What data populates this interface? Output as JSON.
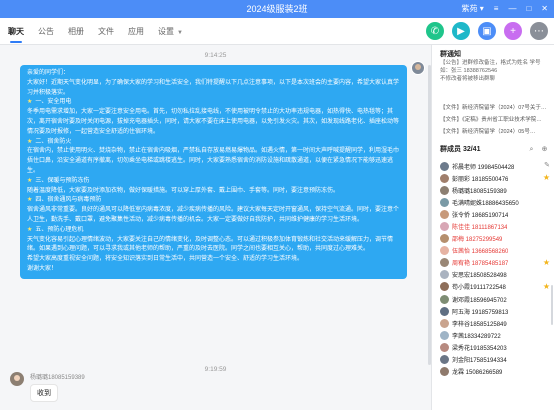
{
  "window": {
    "title": "2024级服装2班",
    "user_menu": "紫苑 ▾",
    "controls": [
      "≡",
      "—",
      "□",
      "✕"
    ]
  },
  "tabs": [
    {
      "label": "聊天",
      "active": true
    },
    {
      "label": "公告"
    },
    {
      "label": "相册"
    },
    {
      "label": "文件"
    },
    {
      "label": "应用"
    },
    {
      "label": "设置",
      "dropdown": true
    }
  ],
  "tab_actions": [
    {
      "icon": "phone-icon",
      "color": "#1fc58b",
      "glyph": "✆"
    },
    {
      "icon": "video-call-icon",
      "color": "#1fb8c9",
      "glyph": "▶"
    },
    {
      "icon": "screen-share-icon",
      "color": "#4c8df7",
      "glyph": "▣"
    },
    {
      "icon": "add-app-icon",
      "color": "#c86df0",
      "glyph": "+"
    },
    {
      "icon": "more-icon",
      "color": "#8a8f98",
      "glyph": "⋯"
    }
  ],
  "chat": {
    "timestamp_1": "9:14:25",
    "timestamp_2": "9:19:59",
    "announcement": {
      "greeting": "亲爱的同学们：",
      "intro": "大家好！近期天气变化明显，为了确保大家的学习和生活安全，我们特提醒以下几点注意事项，以下是本次班会的主要内容，希望大家认真学习并积极落实。",
      "sections": [
        {
          "heading": "一、安全用电",
          "body": "冬季用电需求增加，大家一定要注意安全用电。首先，切勿私拉乱接电线，不使用被明令禁止的大功率违规电器，如热得快、电热毯等；其次，离开宿舍时要及时关闭电源，拔掉充电器插头，同时，请大家不要在床上使用电器，以免引发火灾。其次，如发现线路老化、插座松动等情况要及时报修，一起营造安全舒适的住宿环境。"
        },
        {
          "heading": "二、宿舍防火",
          "body": "在宿舍内，禁止使用明火、焚烧杂物，禁止在宿舍内吸烟，严禁私自存放易燃易爆物品。如遇火情，第一时间大声呼喊提醒同学，利用湿毛巾捂住口鼻，沿安全通道有序撤离，切勿乘坐电梯或跳楼逃生。同时，大家要熟悉宿舍的消防设施和疏散通道，以便在紧急情况下能够迅速逃生。"
        },
        {
          "heading": "三、保暖与预防冻伤",
          "body": "随着温度降低，大家要及时添加衣物，做好保暖措施。可以穿上厚外套、戴上围巾、手套等。同时，要注意预防冻伤。"
        },
        {
          "heading": "四、宿舍通风与病毒预防",
          "body": "宿舍通风非常重要。良好的通风可以降低室内病毒浓度，减少疾病传播的风险。建议大家每天定时开窗通风，保持空气流通。同时，要注意个人卫生，勤洗手、戴口罩，避免聚集性活动，减少病毒传播的机会。大家一定要做好自我防护，共同维护健康的学习生活环境。"
        },
        {
          "heading": "五、预防心理危机",
          "body": "天气变化容易引起心理情绪波动，大家要关注自己的情绪变化，及时调整心态。可以通过积极参加体育锻炼和社交活动来缓解压力，调节情绪。如果遇到心理问题，可以寻求我或其他老师的帮助，严重的及时去医院。同学之间也要相互关心，帮助，共同度过心理难关。"
        }
      ],
      "closing": "希望大家高度重视安全问题，将安全知识落实到日常生活中，共同营造一个安全、舒适的学习生活环境。",
      "thanks": "谢谢大家！"
    },
    "reply": {
      "sender": "杨璐璐18085159389",
      "text": "收到"
    }
  },
  "panel": {
    "notice_title": "群通知",
    "notice_lines": [
      {
        "text": "【公告】进群修改备注，格式为姓名 学号",
        "highlight": false
      },
      {
        "text": "如：张三 18388762546",
        "highlight": false
      },
      {
        "text": "不修改者将被移出群聊",
        "highlight": false
      }
    ],
    "files": [
      "【文件】新经济院留学（2024）07号关于…",
      "【文件】《定稿》贵州省工职业技术学院…",
      "【文件】新经济院留学（2024）05号…"
    ],
    "members_label": "群成员 32/41",
    "members": [
      {
        "name": "祁晨老师 19984504428",
        "color": "#6d7b8c",
        "red": false,
        "edit": true
      },
      {
        "name": "彭丽彩 18185500476",
        "color": "#a07f6c",
        "red": false,
        "star": true
      },
      {
        "name": "杨璐璐18085159389",
        "color": "#8c7f72",
        "red": false
      },
      {
        "name": "毛满晴妮姝18886435650",
        "color": "#7a9aa6",
        "red": false
      },
      {
        "name": "张令侨 18685190714",
        "color": "#c79a7b",
        "red": false
      },
      {
        "name": "陈佳佳 18111867134",
        "color": "#d8a7b5",
        "red": true
      },
      {
        "name": "邵梅 18275299549",
        "color": "#b58f6d",
        "red": true
      },
      {
        "name": "伍茜怡 13668568260",
        "color": "#e6b3a3",
        "red": true
      },
      {
        "name": "周宥艳 18785485187",
        "color": "#9a8776",
        "red": true,
        "star": true
      },
      {
        "name": "安思宏18508528498",
        "color": "#aab3c0",
        "red": false
      },
      {
        "name": "苟小霞19111722548",
        "color": "#8e6f5b",
        "red": false,
        "star": true
      },
      {
        "name": "谢邓霞18596945702",
        "color": "#7e8d74",
        "red": false
      },
      {
        "name": "阿五海  19185759813",
        "color": "#5f6f83",
        "red": false
      },
      {
        "name": "李梓谷18585125849",
        "color": "#c9a48e",
        "red": false
      },
      {
        "name": "李茜18334289722",
        "color": "#9fb4c6",
        "red": false
      },
      {
        "name": "梁秀花19185354203",
        "color": "#b78a80",
        "red": false
      },
      {
        "name": "刘金阳17585194334",
        "color": "#6b7686",
        "red": false
      },
      {
        "name": "龙霖  15086266589",
        "color": "#8f7a6c",
        "red": false
      }
    ]
  }
}
